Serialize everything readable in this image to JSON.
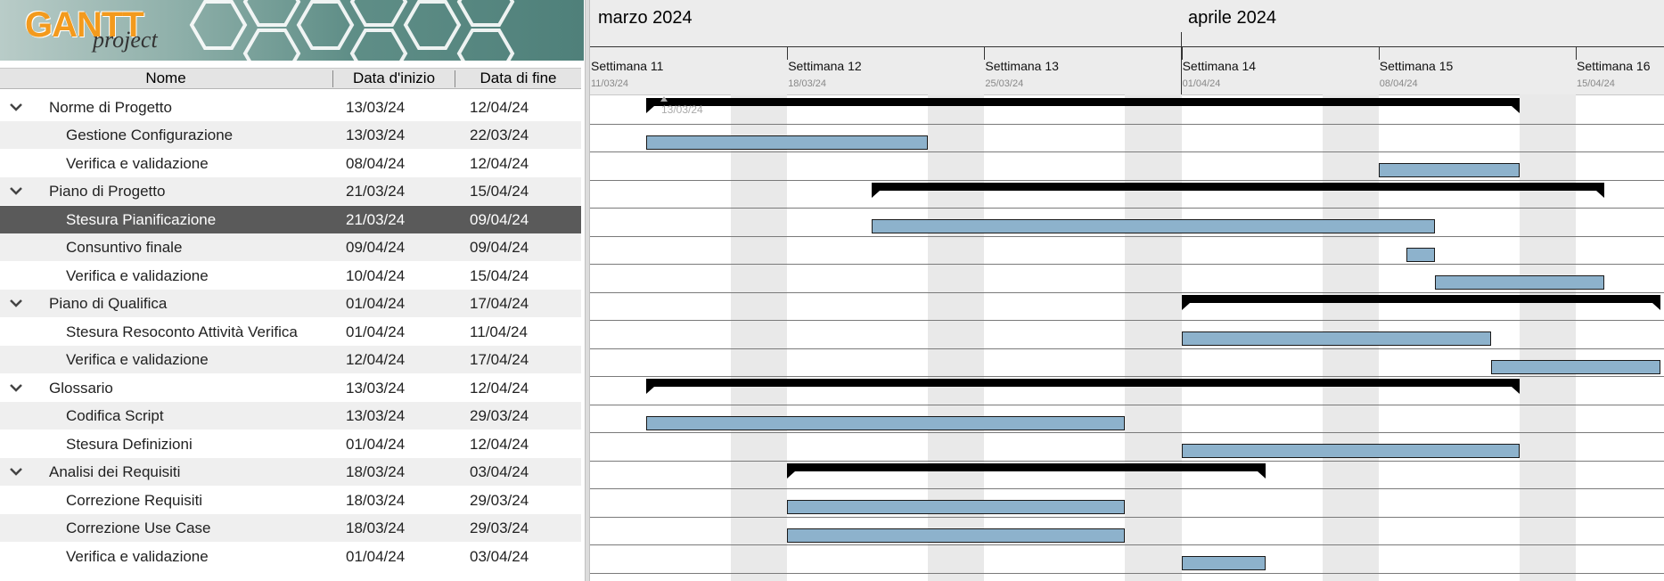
{
  "app": {
    "logo_main": "GANTT",
    "logo_sub": "project"
  },
  "table": {
    "columns": [
      "Nome",
      "Data d'inizio",
      "Data di fine"
    ],
    "rows": [
      {
        "name": "Norme di Progetto",
        "start": "13/03/24",
        "end": "12/04/24",
        "level": 0,
        "summary": true
      },
      {
        "name": "Gestione Configurazione",
        "start": "13/03/24",
        "end": "22/03/24",
        "level": 1,
        "summary": false
      },
      {
        "name": "Verifica e validazione",
        "start": "08/04/24",
        "end": "12/04/24",
        "level": 1,
        "summary": false
      },
      {
        "name": "Piano di Progetto",
        "start": "21/03/24",
        "end": "15/04/24",
        "level": 0,
        "summary": true
      },
      {
        "name": "Stesura Pianificazione",
        "start": "21/03/24",
        "end": "09/04/24",
        "level": 1,
        "summary": false,
        "selected": true
      },
      {
        "name": "Consuntivo finale",
        "start": "09/04/24",
        "end": "09/04/24",
        "level": 1,
        "summary": false
      },
      {
        "name": "Verifica e validazione",
        "start": "10/04/24",
        "end": "15/04/24",
        "level": 1,
        "summary": false
      },
      {
        "name": "Piano di Qualifica",
        "start": "01/04/24",
        "end": "17/04/24",
        "level": 0,
        "summary": true
      },
      {
        "name": "Stesura Resoconto Attività Verifica",
        "start": "01/04/24",
        "end": "11/04/24",
        "level": 1,
        "summary": false
      },
      {
        "name": "Verifica e validazione",
        "start": "12/04/24",
        "end": "17/04/24",
        "level": 1,
        "summary": false
      },
      {
        "name": "Glossario",
        "start": "13/03/24",
        "end": "12/04/24",
        "level": 0,
        "summary": true
      },
      {
        "name": "Codifica Script",
        "start": "13/03/24",
        "end": "29/03/24",
        "level": 1,
        "summary": false
      },
      {
        "name": "Stesura Definizioni",
        "start": "01/04/24",
        "end": "12/04/24",
        "level": 1,
        "summary": false
      },
      {
        "name": "Analisi dei Requisiti",
        "start": "18/03/24",
        "end": "03/04/24",
        "level": 0,
        "summary": true
      },
      {
        "name": "Correzione Requisiti",
        "start": "18/03/24",
        "end": "29/03/24",
        "level": 1,
        "summary": false
      },
      {
        "name": "Correzione Use Case",
        "start": "18/03/24",
        "end": "29/03/24",
        "level": 1,
        "summary": false
      },
      {
        "name": "Verifica e validazione",
        "start": "01/04/24",
        "end": "03/04/24",
        "level": 1,
        "summary": false
      }
    ]
  },
  "chart": {
    "months": [
      "marzo 2024",
      "aprile 2024"
    ],
    "weeks": [
      {
        "label": "Settimana  11",
        "date": "11/03/24"
      },
      {
        "label": "Settimana  12",
        "date": "18/03/24"
      },
      {
        "label": "Settimana  13",
        "date": "25/03/24"
      },
      {
        "label": "Settimana  14",
        "date": "01/04/24"
      },
      {
        "label": "Settimana  15",
        "date": "08/04/24"
      },
      {
        "label": "Settimana  16",
        "date": "15/04/24"
      }
    ],
    "today_marker": "13/03/24",
    "colors": {
      "task_bar": "#8db2cc",
      "summary_bar": "#000000",
      "selection": "#5a5a5a",
      "selection_accent": "#f0a52c"
    }
  }
}
